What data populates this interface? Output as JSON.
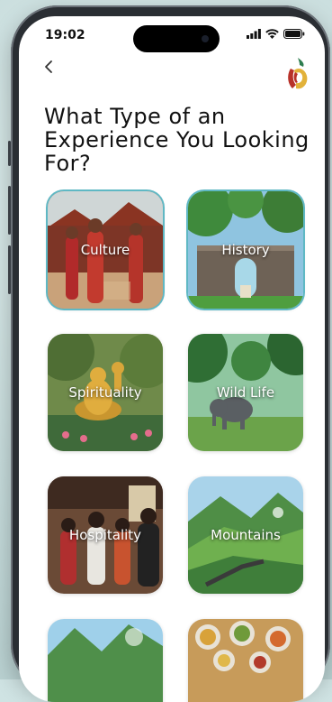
{
  "status_bar": {
    "time": "19:02"
  },
  "page": {
    "title": "What Type of an Experience You Looking For?"
  },
  "experiences": [
    {
      "label": "Culture",
      "selected": true
    },
    {
      "label": "History",
      "selected": true
    },
    {
      "label": "Spirituality",
      "selected": false
    },
    {
      "label": "Wild Life",
      "selected": false
    },
    {
      "label": "Hospitality",
      "selected": false
    },
    {
      "label": "Mountains",
      "selected": false
    },
    {
      "label": "",
      "selected": false
    },
    {
      "label": "",
      "selected": false
    }
  ],
  "colors": {
    "accent": "#5fb8c4",
    "logo_red": "#b8322a",
    "logo_yellow": "#e2b23a",
    "logo_green": "#2e7d4f"
  }
}
